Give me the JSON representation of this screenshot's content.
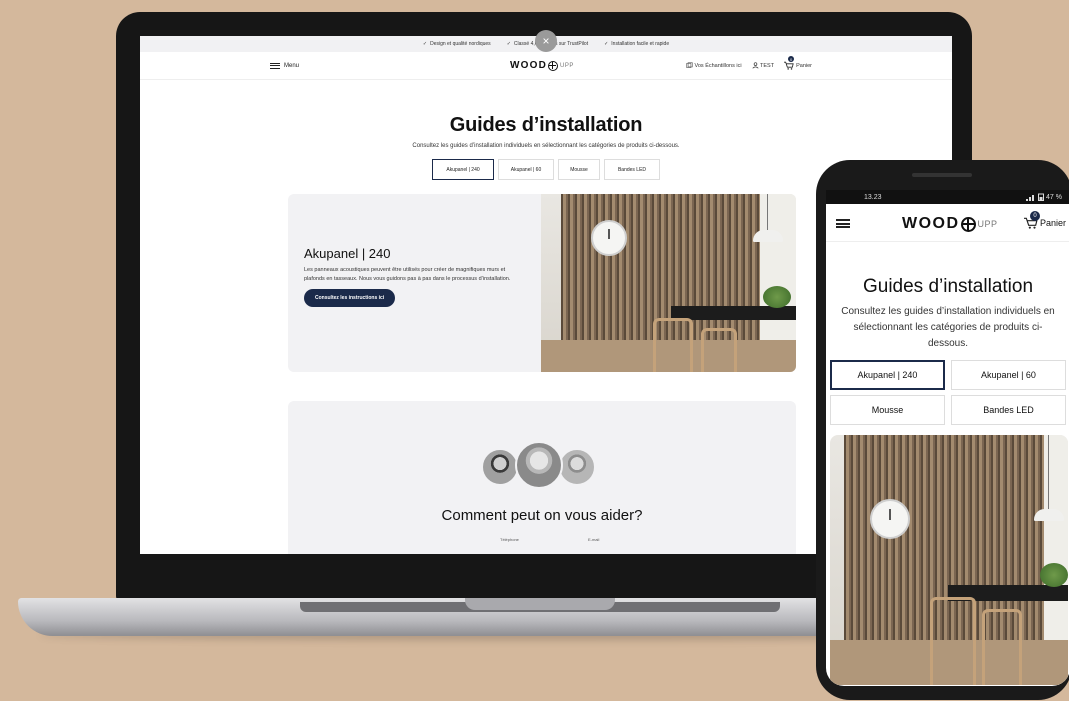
{
  "laptop": {
    "usp": [
      "Design et qualité nordiques",
      "Classé 4,6/5 étoiles sur TrustPilot",
      "Installation facile et rapide"
    ],
    "close_glyph": "×",
    "header": {
      "menu_label": "Menu",
      "logo_main": "WOOD",
      "logo_suffix": "UPP",
      "samples_label": "Vos Échantillons ici",
      "account_label": "TEST",
      "cart_label": "Panier",
      "cart_count": "0"
    },
    "main": {
      "title": "Guides d’installation",
      "subtitle": "Consultez les guides d’installation individuels en sélectionnant les catégories de produits ci-dessous.",
      "tabs": [
        "Akupanel | 240",
        "Akupanel | 60",
        "Mousse",
        "Bandes LED"
      ],
      "product": {
        "name": "Akupanel | 240",
        "description": "Les panneaux acoustiques peuvent être utilisés pour créer de magnifiques murs et plafonds en tasseaux. Nous vous guidons pas à pas dans le processus d’installation.",
        "cta": "Consultez les instructions ici"
      },
      "help": {
        "title": "Comment peut on vous aider?",
        "phone_label": "Téléphone",
        "email_label": "E-mail"
      }
    }
  },
  "phone": {
    "status": {
      "time": "13.23",
      "battery": "47 %"
    },
    "header": {
      "logo_main": "WOOD",
      "logo_suffix": "UPP",
      "cart_label": "Panier",
      "cart_count": "0"
    },
    "title": "Guides d’installation",
    "subtitle": "Consultez les guides d’installation individuels en sélectionnant les catégories de produits ci-dessous.",
    "tabs": [
      "Akupanel | 240",
      "Akupanel | 60",
      "Mousse",
      "Bandes LED"
    ]
  },
  "colors": {
    "background": "#d4b89c",
    "accent_navy": "#1b2a4a",
    "card_gray": "#f2f2f4"
  },
  "icons": {
    "menu": "hamburger-icon",
    "logo": "wheel-logo-icon",
    "samples": "samples-icon",
    "account": "user-icon",
    "cart": "cart-icon",
    "check": "check-icon",
    "close": "close-icon"
  }
}
